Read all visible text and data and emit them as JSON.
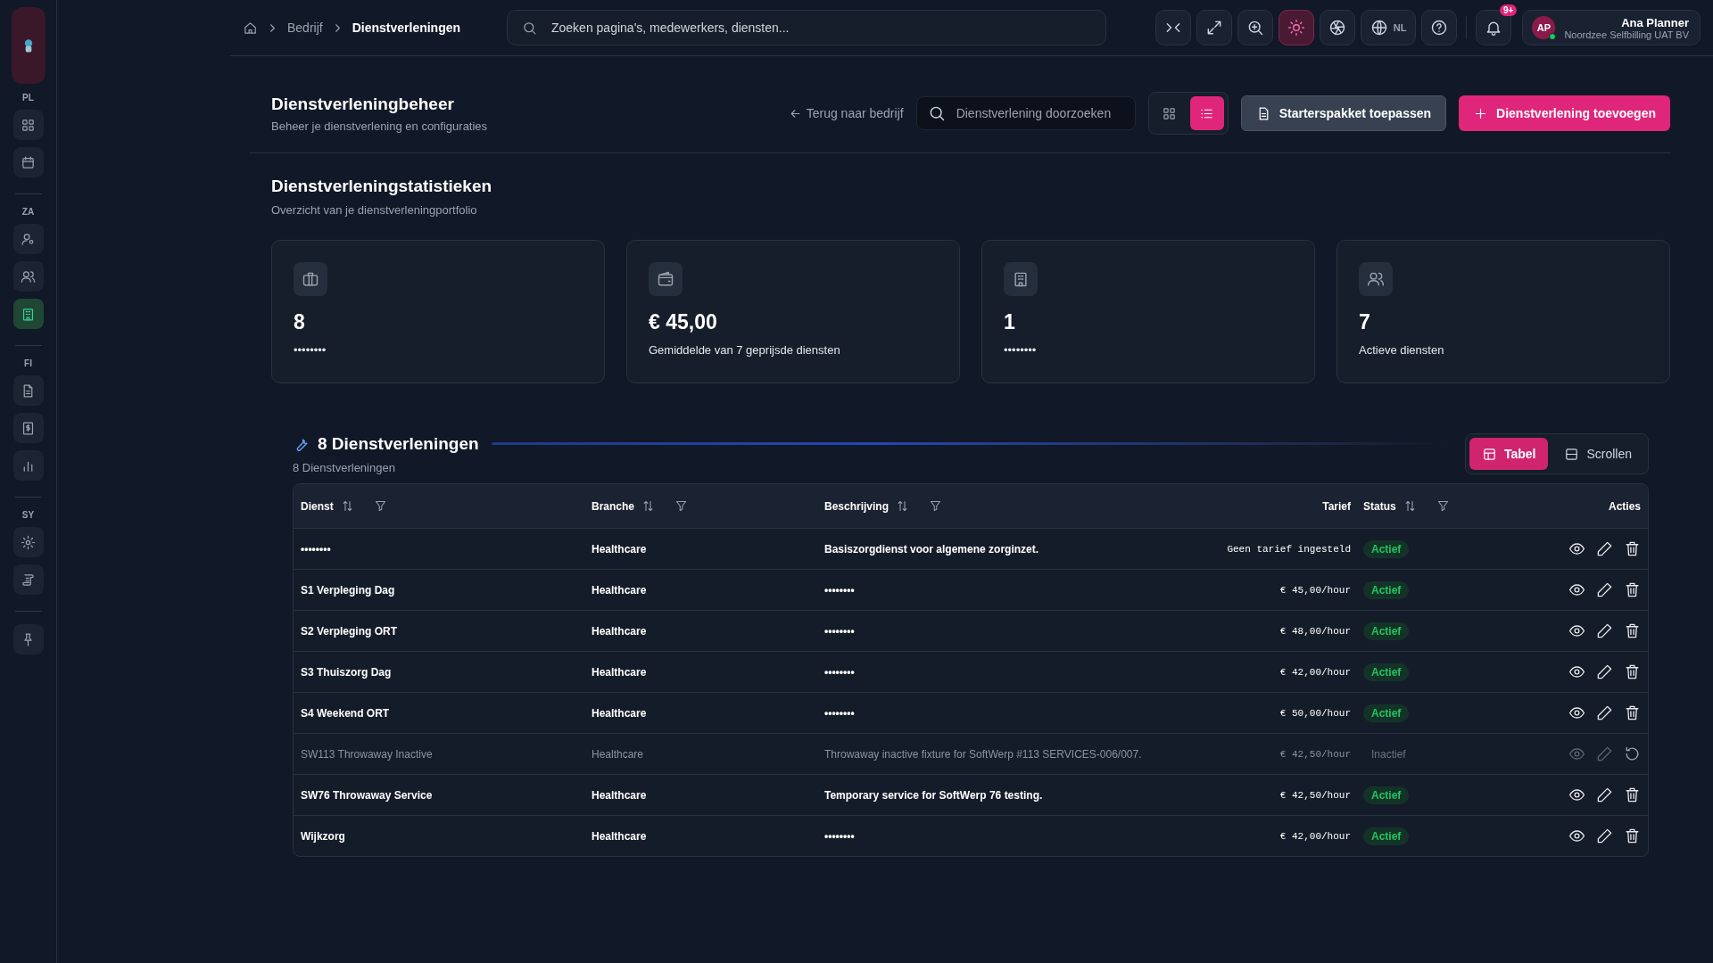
{
  "sidebar": {
    "groups": [
      {
        "label": "PL",
        "items": [
          {
            "kind": "grid",
            "selected": false
          },
          {
            "kind": "calendar",
            "selected": false
          }
        ]
      },
      {
        "label": "ZA",
        "items": [
          {
            "kind": "user-gear",
            "selected": false
          },
          {
            "kind": "users",
            "selected": false
          },
          {
            "kind": "building",
            "selected": true
          }
        ]
      },
      {
        "label": "FI",
        "items": [
          {
            "kind": "document",
            "selected": false
          },
          {
            "kind": "receipt",
            "selected": false
          },
          {
            "kind": "chart",
            "selected": false
          }
        ]
      },
      {
        "label": "SY",
        "items": [
          {
            "kind": "gear",
            "selected": false
          },
          {
            "kind": "scroll",
            "selected": false
          }
        ]
      }
    ],
    "footer_items": [
      {
        "kind": "pin",
        "selected": false
      }
    ]
  },
  "breadcrumb": [
    "Bedrijf",
    "Dienstverleningen"
  ],
  "search": {
    "placeholder": "Zoeken pagina's, medewerkers, diensten..."
  },
  "toolbar": [
    {
      "kind": "collapse",
      "active": false
    },
    {
      "kind": "expand",
      "active": false
    },
    {
      "kind": "zoom",
      "active": false
    },
    {
      "kind": "sun",
      "active": true
    },
    {
      "kind": "aperture",
      "active": false
    }
  ],
  "language": "NL",
  "notifications": {
    "badge": "9+"
  },
  "user": {
    "initials": "AP",
    "name": "Ana Planner",
    "org": "Noordzee Selfbilling UAT BV",
    "online": true
  },
  "page": {
    "title": "Dienstverleningbeheer",
    "subtitle": "Beheer je dienstverlening en configuraties",
    "back": "Terug naar bedrijf",
    "search_placeholder": "Dienstverlening doorzoeken",
    "views": [
      {
        "kind": "grid",
        "selected": false
      },
      {
        "kind": "list",
        "selected": true
      }
    ],
    "starter_button": "Starterspakket toepassen",
    "add_button": "Dienstverlening toevoegen"
  },
  "stats": {
    "title": "Dienstverleningstatistieken",
    "subtitle": "Overzicht van je dienstverleningportfolio",
    "cards": [
      {
        "kind": "briefcase",
        "value": "8",
        "label": "••••••••"
      },
      {
        "kind": "wallet",
        "value": "€ 45,00",
        "label": "Gemiddelde van 7 geprijsde diensten"
      },
      {
        "kind": "building",
        "value": "1",
        "label": "••••••••"
      },
      {
        "kind": "users",
        "value": "7",
        "label": "Actieve diensten"
      }
    ]
  },
  "list": {
    "title": "8 Dienstverleningen",
    "subtitle": "8 Dienstverleningen",
    "modes": [
      {
        "label": "Tabel",
        "kind": "table",
        "selected": true
      },
      {
        "label": "Scrollen",
        "kind": "rows",
        "selected": false
      }
    ],
    "columns": [
      {
        "label": "Dienst",
        "sortable": true,
        "filter": true
      },
      {
        "label": "Branche",
        "sortable": true,
        "filter": true
      },
      {
        "label": "Beschrijving",
        "sortable": true,
        "filter": true
      },
      {
        "label": "Tarief",
        "sortable": false,
        "filter": false
      },
      {
        "label": "Status",
        "sortable": true,
        "filter": true
      },
      {
        "label": "Acties",
        "sortable": false,
        "filter": false
      }
    ],
    "rows": [
      {
        "name": "••••••••",
        "branch": "Healthcare",
        "description": "Basiszorgdienst voor algemene zorginzet.",
        "rate": "Geen tarief ingesteld",
        "status": "Actief",
        "active": true
      },
      {
        "name": "S1 Verpleging Dag",
        "branch": "Healthcare",
        "description": "••••••••",
        "rate": "€ 45,00/hour",
        "status": "Actief",
        "active": true
      },
      {
        "name": "S2 Verpleging ORT",
        "branch": "Healthcare",
        "description": "••••••••",
        "rate": "€ 48,00/hour",
        "status": "Actief",
        "active": true
      },
      {
        "name": "S3 Thuiszorg Dag",
        "branch": "Healthcare",
        "description": "••••••••",
        "rate": "€ 42,00/hour",
        "status": "Actief",
        "active": true
      },
      {
        "name": "S4 Weekend ORT",
        "branch": "Healthcare",
        "description": "••••••••",
        "rate": "€ 50,00/hour",
        "status": "Actief",
        "active": true
      },
      {
        "name": "SW113 Throwaway Inactive",
        "branch": "Healthcare",
        "description": "Throwaway inactive fixture for SoftWerp #113 SERVICES-006/007.",
        "rate": "€ 42,50/hour",
        "status": "Inactief",
        "active": false
      },
      {
        "name": "SW76 Throwaway Service",
        "branch": "Healthcare",
        "description": "Temporary service for SoftWerp 76 testing.",
        "rate": "€ 42,50/hour",
        "status": "Actief",
        "active": true
      },
      {
        "name": "Wijkzorg",
        "branch": "Healthcare",
        "description": "••••••••",
        "rate": "€ 42,00/hour",
        "status": "Actief",
        "active": true
      }
    ]
  }
}
